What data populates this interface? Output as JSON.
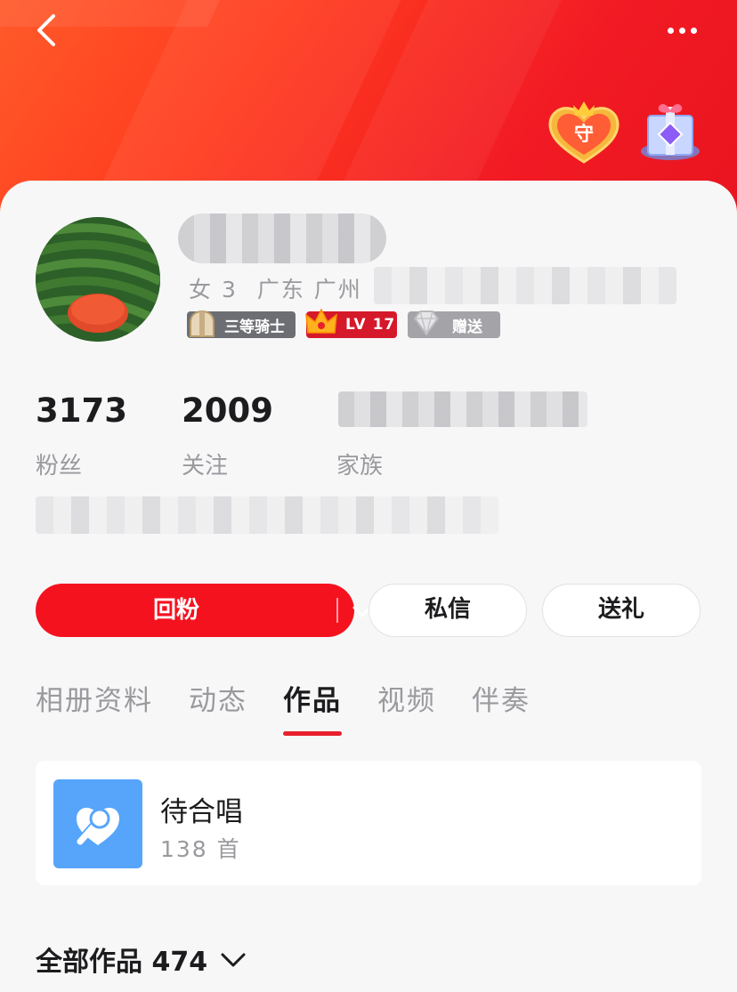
{
  "header": {
    "accent_gradient": [
      "#ff5a2a",
      "#e9141f"
    ],
    "back_icon": "chevron-left-icon",
    "more_icon": "more-dots-icon",
    "guard_badge_text": "守",
    "gift_badge_icon": "gift-box-icon"
  },
  "profile": {
    "gender_age": "女 3",
    "location": "广东 广州",
    "badges": {
      "knight": "三等骑士",
      "level": "LV 17",
      "gift": "赠送"
    }
  },
  "stats": [
    {
      "value": "3173",
      "label": "粉丝"
    },
    {
      "value": "2009",
      "label": "关注"
    },
    {
      "value": "",
      "label": "家族"
    }
  ],
  "actions": {
    "follow_back": "回粉",
    "message": "私信",
    "send_gift": "送礼"
  },
  "tabs": [
    "相册资料",
    "动态",
    "作品",
    "视频",
    "伴奏"
  ],
  "active_tab": "作品",
  "works_card": {
    "title": "待合唱",
    "count": "138 首",
    "icon": "microphone-heart-icon",
    "icon_color": "#56a5fb"
  },
  "all_works": {
    "label": "全部作品 474"
  },
  "colors": {
    "primary_red": "#f5121f",
    "tab_indicator": "#e8202c",
    "text_dark": "#1c1c1e",
    "text_gray": "#9a9a9e"
  }
}
